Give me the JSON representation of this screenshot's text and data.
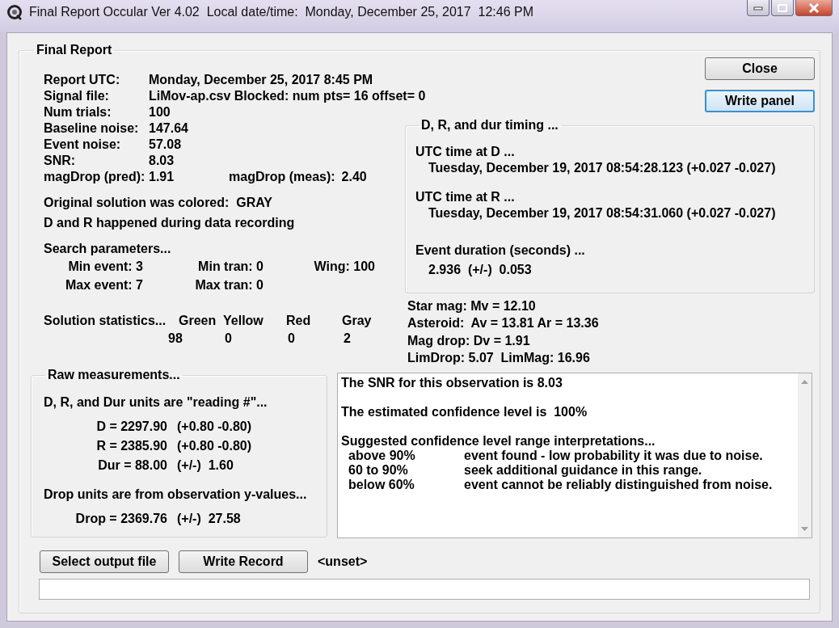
{
  "window": {
    "title": "Final Report Occular Ver 4.02  Local date/time:  Monday, December 25, 2017  12:46 PM"
  },
  "report": {
    "title": "Final Report",
    "fields": [
      {
        "label": "Report UTC:",
        "value": "Monday, December 25, 2017 8:45 PM"
      },
      {
        "label": "Signal file:",
        "value": "LiMov-ap.csv Blocked: num pts= 16 offset= 0"
      },
      {
        "label": "Num trials:",
        "value": "100"
      },
      {
        "label": "Baseline noise:",
        "value": "147.64"
      },
      {
        "label": "Event noise:",
        "value": "57.08"
      },
      {
        "label": "SNR:",
        "value": "8.03"
      }
    ],
    "mag_drop": [
      {
        "label": "magDrop (pred):",
        "value": "1.91"
      },
      {
        "label": "magDrop (meas):",
        "value": "2.40"
      }
    ],
    "notes": [
      "Original solution was colored:  GRAY",
      "D and R happened during data recording"
    ],
    "search_parameters": {
      "title": "Search parameters...",
      "items": [
        "Min event: 3",
        "Min tran: 0",
        "Wing: 100",
        "Max event: 7",
        "Max tran: 0"
      ]
    },
    "solution_statistics": {
      "title": "Solution statistics...",
      "columns": [
        {
          "name": "Green",
          "count": "98"
        },
        {
          "name": "Yellow",
          "count": "0"
        },
        {
          "name": "Red",
          "count": "0"
        },
        {
          "name": "Gray",
          "count": "2"
        }
      ]
    },
    "buttons": [
      {
        "label": "Close",
        "focused": false
      },
      {
        "label": "Write panel",
        "focused": true
      }
    ],
    "timing": {
      "title": "D, R, and dur timing ...",
      "sections": [
        {
          "heading": "UTC time at D ...",
          "value": "Tuesday, December 19, 2017 08:54:28.123 (+0.027 -0.027)"
        },
        {
          "heading": "UTC time at R ...",
          "value": "Tuesday, December 19, 2017 08:54:31.060 (+0.027 -0.027)"
        },
        {
          "heading": "Event duration (seconds) ...",
          "value": "2.936  (+/-)  0.053"
        }
      ]
    },
    "magnitudes": [
      "Star mag: Mv = 12.10",
      "Asteroid:  Av = 13.81 Ar = 13.36",
      "Mag drop: Dv = 1.91",
      "LimDrop: 5.07  LimMag: 16.96"
    ],
    "raw_measurements": {
      "title": "Raw measurements...",
      "units_note": "D, R, and Dur units are \"reading #\"...",
      "rows": [
        {
          "name": "D = 2297.90",
          "error": "(+0.80 -0.80)"
        },
        {
          "name": "R = 2385.90",
          "error": "(+0.80 -0.80)"
        },
        {
          "name": "Dur = 88.00",
          "error": "(+/-)  1.60"
        }
      ],
      "drop_note": "Drop units are from observation y-values...",
      "drop": {
        "name": "Drop = 2369.76",
        "error": "(+/-)  27.58"
      }
    },
    "confidence_text": {
      "paragraphs": [
        "The SNR for this observation is 8.03",
        "The estimated confidence level is  100%",
        "Suggested confidence level range interpretations..."
      ],
      "interpretations": [
        {
          "range": "above 90%",
          "meaning": "event found - low probability it was due to noise."
        },
        {
          "range": "60 to 90%",
          "meaning": "seek additional guidance in this range."
        },
        {
          "range": "below 60%",
          "meaning": "event cannot be reliably distinguished from noise."
        }
      ]
    },
    "output": {
      "buttons": [
        "Select output file",
        "Write Record"
      ],
      "file": "<unset>"
    }
  }
}
